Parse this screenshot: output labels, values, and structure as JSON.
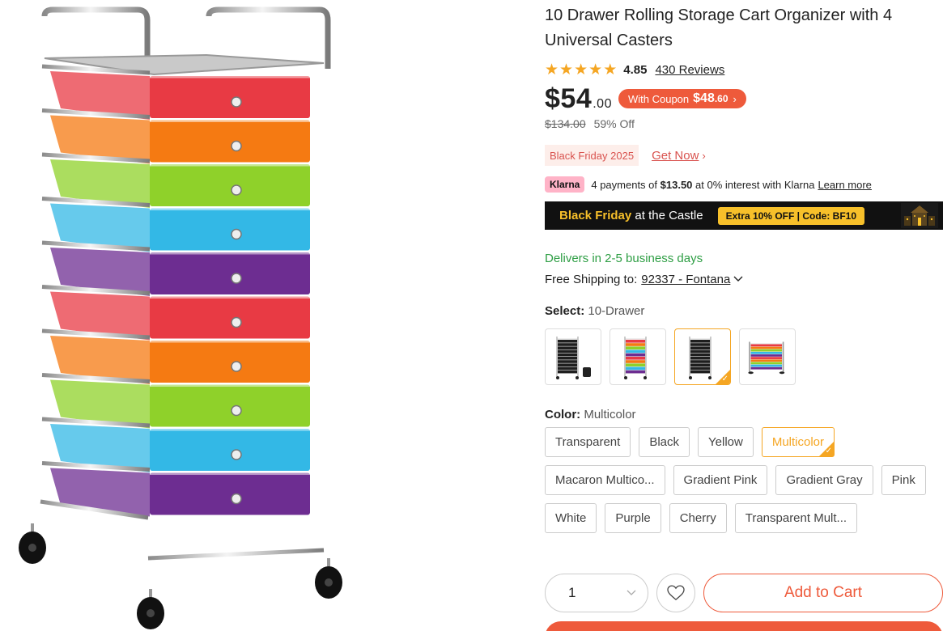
{
  "product": {
    "title": "10 Drawer Rolling Storage Cart Organizer with 4 Universal Casters",
    "rating": "4.85",
    "stars": 5,
    "reviews": "430 Reviews",
    "price_main": "$54",
    "price_cents": ".00",
    "coupon_label": "With Coupon",
    "coupon_main": "$48",
    "coupon_cents": ".60",
    "was_price": "$134.00",
    "discount": "59% Off"
  },
  "promo": {
    "tag": "Black Friday 2025",
    "link": "Get Now"
  },
  "klarna": {
    "badge": "Klarna",
    "prefix": "4 payments of",
    "amount": "$13.50",
    "suffix": "at 0% interest with Klarna",
    "link": "Learn more"
  },
  "banner": {
    "title_bold": "Black Friday",
    "title_rest": "at the Castle",
    "promo": "Extra 10% OFF  |  Code: BF10"
  },
  "shipping": {
    "delivery": "Delivers in 2-5 business days",
    "label": "Free Shipping to:",
    "zip": "92337 - Fontana"
  },
  "select": {
    "label": "Select:",
    "value": "10-Drawer",
    "options": [
      "black-cart-thumb-1",
      "multicolor-cart-thumb-1",
      "black-cart-thumb-2",
      "multicolor-cart-thumb-2"
    ],
    "selected_index": 2
  },
  "color": {
    "label": "Color:",
    "value": "Multicolor",
    "options": [
      "Transparent",
      "Black",
      "Yellow",
      "Multicolor",
      "Macaron Multico...",
      "Gradient Pink",
      "Gradient Gray",
      "Pink",
      "White",
      "Purple",
      "Cherry",
      "Transparent Mult..."
    ],
    "selected_index": 3
  },
  "cart": {
    "quantity": "1",
    "add_label": "Add to Cart"
  },
  "colors": {
    "accent": "#ee5a3b",
    "selected": "#f5a623",
    "delivery": "#2e9e44",
    "drawers": [
      "#e83a44",
      "#f57a12",
      "#8fd12a",
      "#33b8e6",
      "#6d2d91"
    ]
  }
}
